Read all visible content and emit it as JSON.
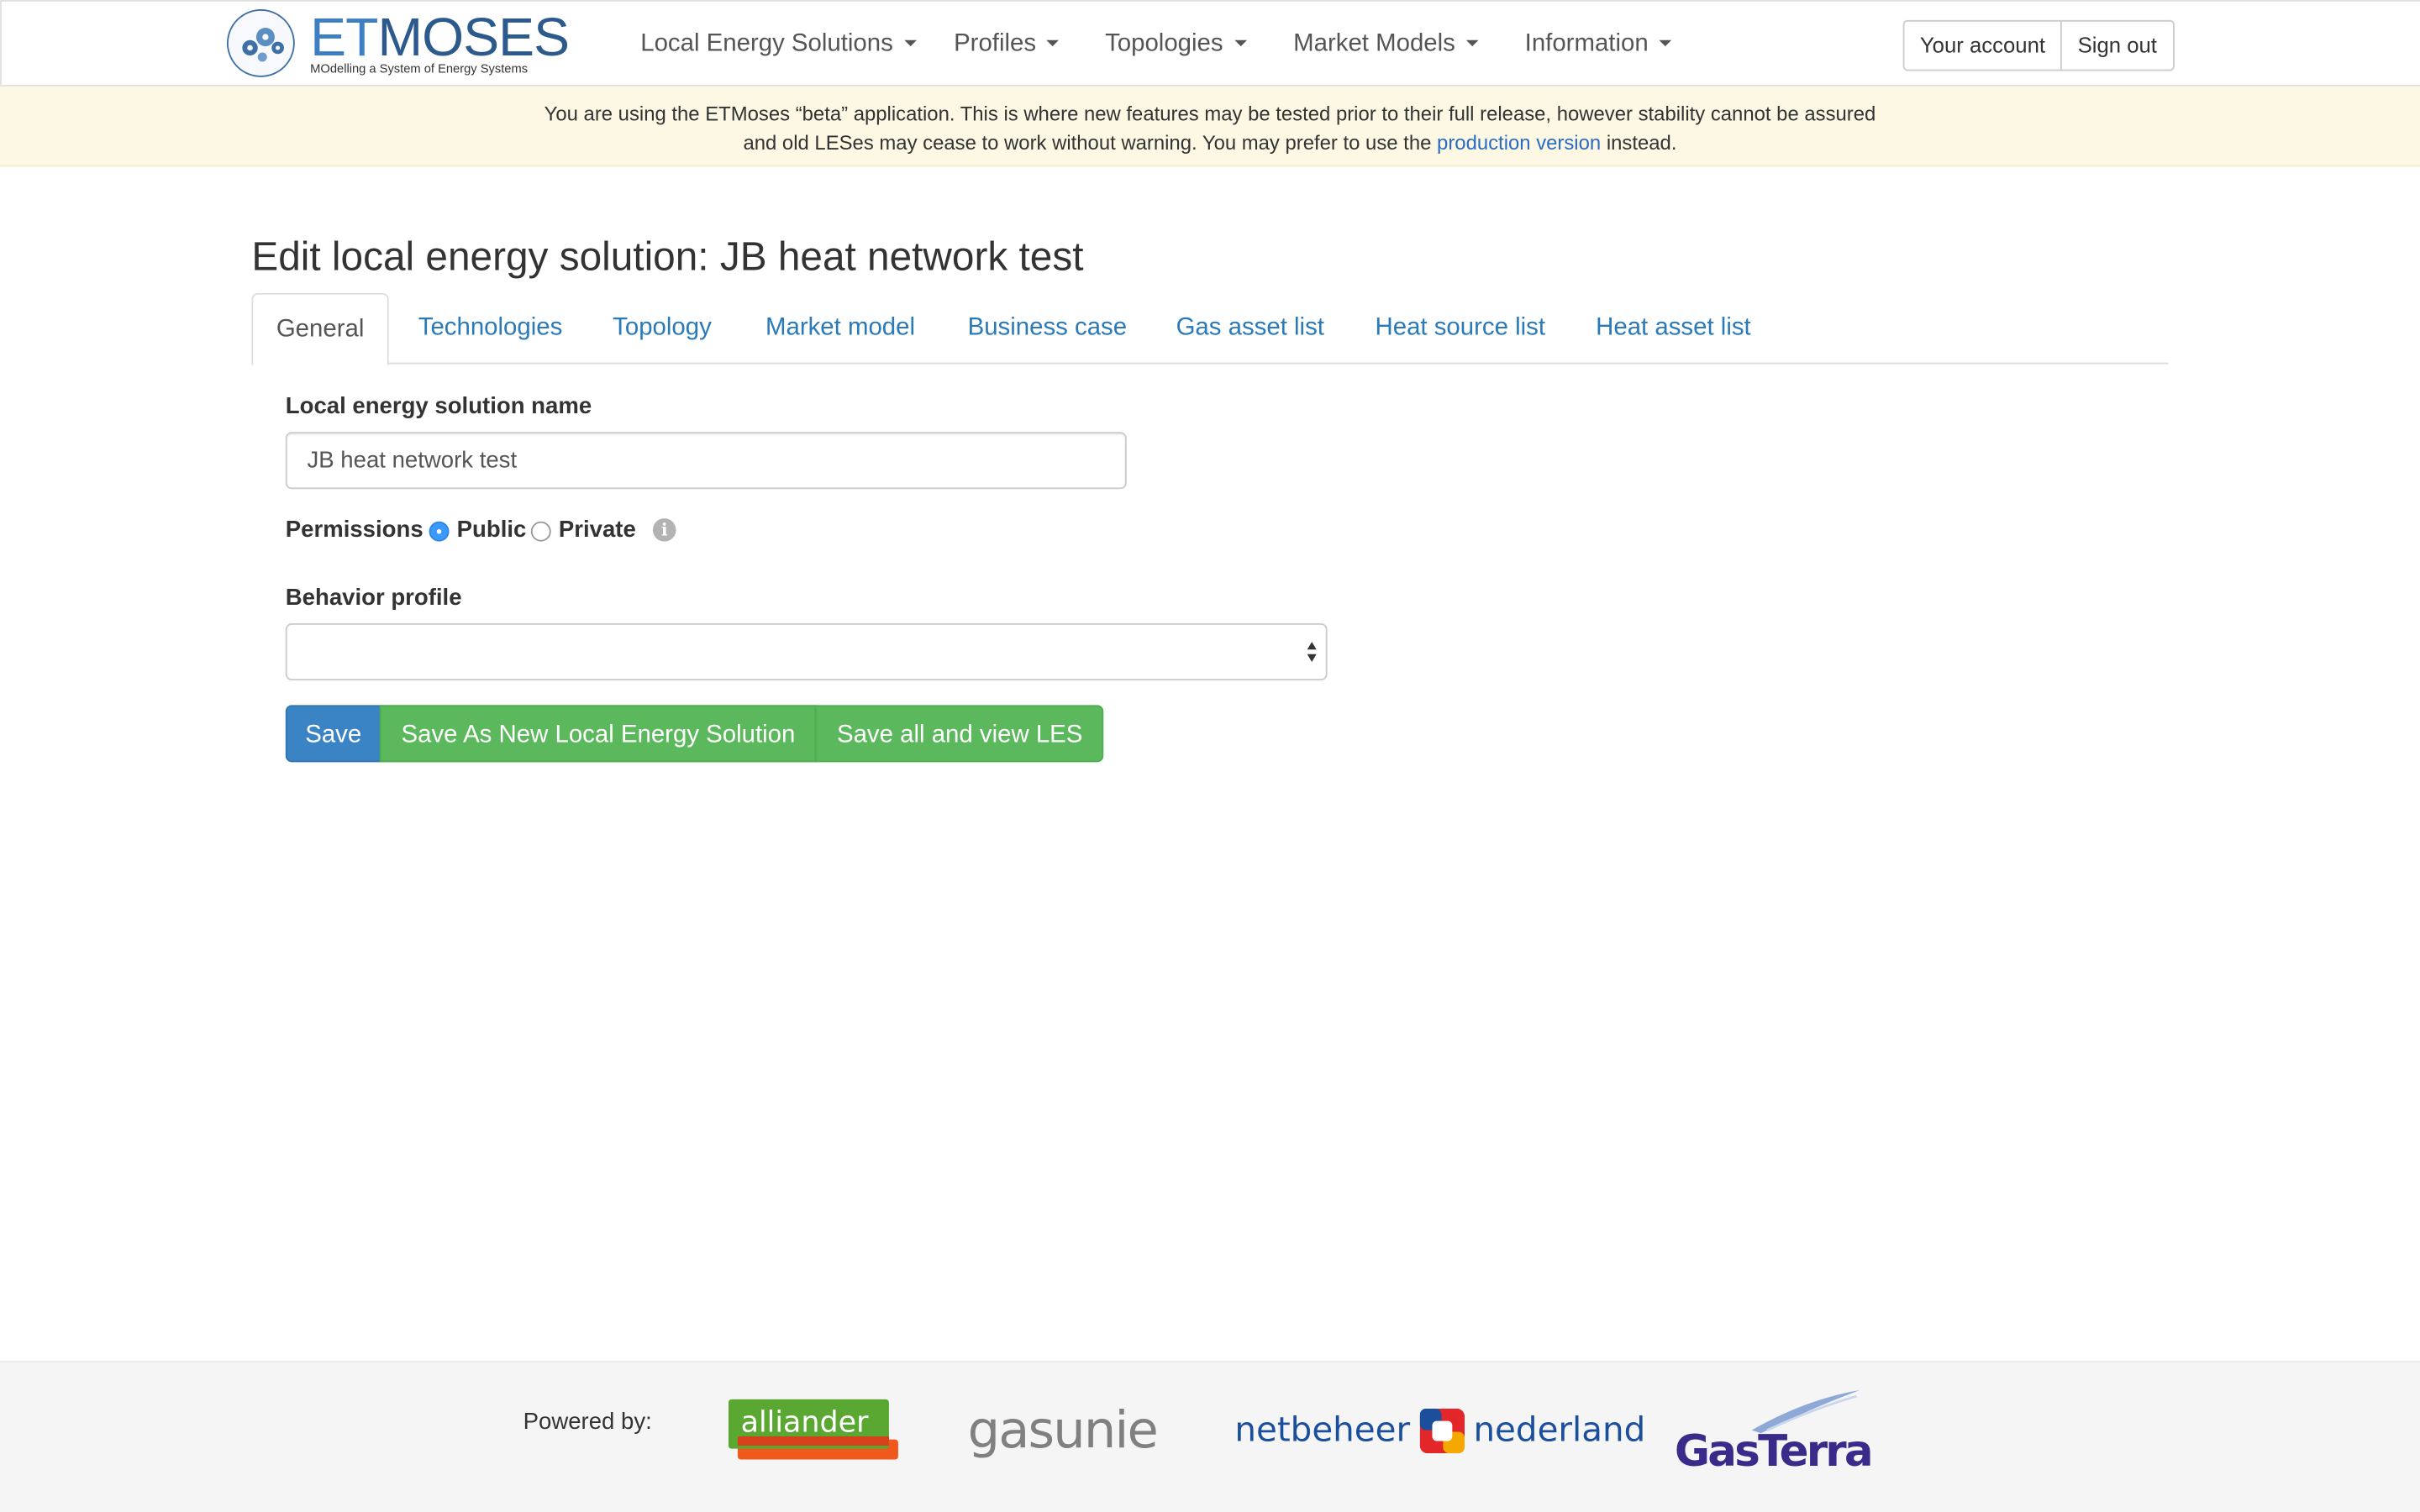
{
  "brand": {
    "title_prefix": "ET",
    "title_suffix": "MOSES",
    "subtitle": "MOdelling a System of Energy Systems"
  },
  "nav": {
    "items": [
      {
        "label": "Local Energy Solutions"
      },
      {
        "label": "Profiles"
      },
      {
        "label": "Topologies"
      },
      {
        "label": "Market Models"
      },
      {
        "label": "Information"
      }
    ],
    "account_label": "Your account",
    "signout_label": "Sign out"
  },
  "banner": {
    "text_before": "You are using the ETMoses “beta” application. This is where new features may be tested prior to their full release, however stability cannot be assured and old LESes may cease to work without warning. You may prefer to use the",
    "link_text": "production version",
    "text_after": "instead."
  },
  "page": {
    "title": "Edit local energy solution: JB heat network test"
  },
  "tabs": [
    {
      "label": "General"
    },
    {
      "label": "Technologies"
    },
    {
      "label": "Topology"
    },
    {
      "label": "Market model"
    },
    {
      "label": "Business case"
    },
    {
      "label": "Gas asset list"
    },
    {
      "label": "Heat source list"
    },
    {
      "label": "Heat asset list"
    }
  ],
  "form": {
    "name_label": "Local energy solution name",
    "name_value": "JB heat network test",
    "permissions_label": "Permissions",
    "permission_public": "Public",
    "permission_private": "Private",
    "permission_selected": "Public",
    "behavior_label": "Behavior profile",
    "behavior_value": ""
  },
  "buttons": {
    "save": "Save",
    "save_as_new": "Save As New Local Energy Solution",
    "save_all_view": "Save all and view LES"
  },
  "footer": {
    "powered_by": "Powered by:",
    "partners": {
      "alliander": "alliander",
      "gasunie": "gasunie",
      "netbeheer_left": "netbeheer",
      "netbeheer_right": "nederland",
      "gasterra": "GasTerra"
    }
  },
  "colors": {
    "link": "#2a7ab9",
    "primary": "#3a84c6",
    "success": "#5cb85c",
    "banner_bg": "#fcf8e3",
    "radio_checked": "#3b99fc"
  }
}
